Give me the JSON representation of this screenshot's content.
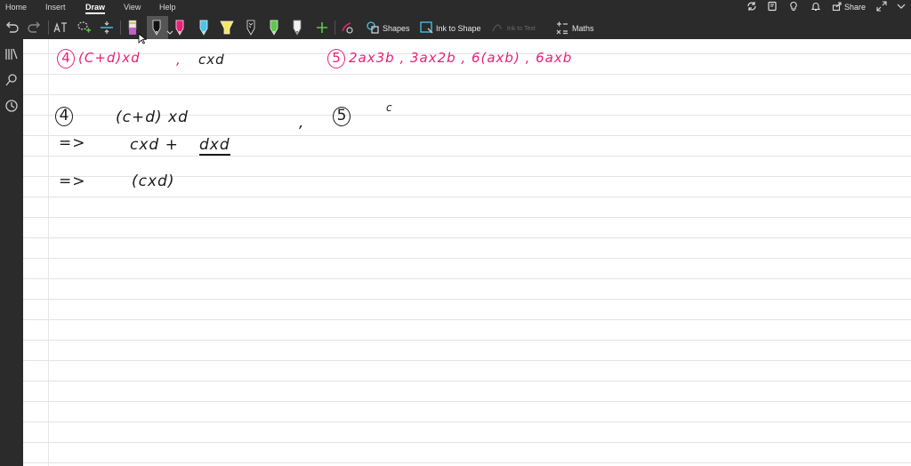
{
  "menubar": {
    "items": [
      "Home",
      "Insert",
      "Draw",
      "View",
      "Help"
    ],
    "active": "Draw",
    "share_label": "Share"
  },
  "toolbar": {
    "shapes_label": "Shapes",
    "ink_to_shape_label": "Ink to Shape",
    "ink_to_text_label": "Ink to Text",
    "maths_label": "Maths"
  },
  "colors": {
    "ribbon": "#2b2b2b",
    "pink_ink": "#e8207a",
    "black_ink": "#1a1a1a",
    "pen_purple": "#c060c8",
    "pen_pink": "#e8207a",
    "pen_cyan": "#4ac6e8",
    "pen_yellow": "#f4e860",
    "pen_green": "#5ec84a"
  },
  "notes": {
    "pink_line": {
      "q4_number": "4",
      "q4_text": "(C+d)xd",
      "comma1": ",",
      "q4_text2": "cxd",
      "q5_number": "5",
      "q5_text": "2ax3b , 3ax2b , 6(axb) , 6axb"
    },
    "black": {
      "q4_number": "4",
      "line1": "(c+d) xd",
      "comma": ",",
      "q5_number": "5",
      "q5_mark": "c",
      "arrow1": "=>",
      "line2a": "cxd +",
      "line2b": "dxd",
      "arrow2": "=>",
      "line3": "(cxd)"
    }
  }
}
